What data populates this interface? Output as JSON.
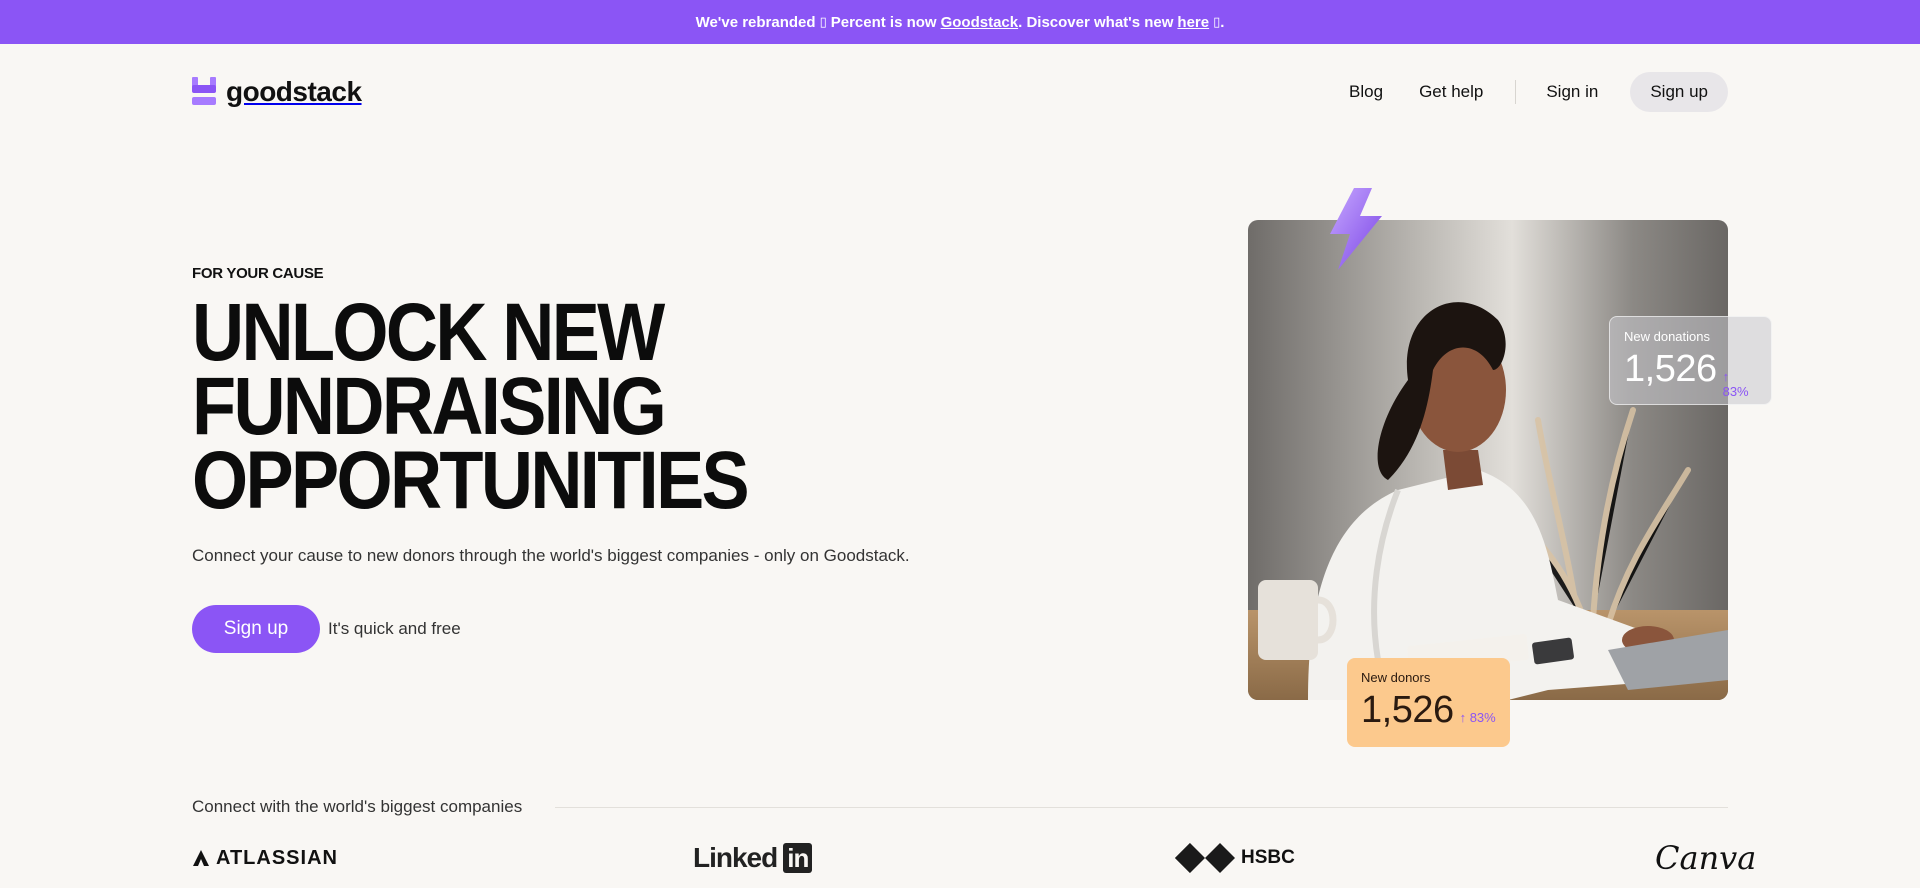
{
  "banner": {
    "prefix": "We've rebranded",
    "glyph_1": "▯",
    "middle": "Percent is now",
    "brand_link": "Goodstack",
    "after_brand": ". Discover what's new",
    "here_link": "here",
    "glyph_2": "▯",
    "end": "."
  },
  "nav": {
    "logo_text": "goodstack",
    "links": [
      "Blog",
      "Get help"
    ],
    "signin": "Sign in",
    "signup": "Sign up"
  },
  "hero": {
    "eyebrow": "FOR YOUR CAUSE",
    "headline": [
      "UNLOCK NEW",
      "FUNDRAISING",
      "OPPORTUNITIES"
    ],
    "subtext": "Connect your cause to new donors through the world's biggest companies - only on Goodstack.",
    "cta": "Sign up",
    "cta_note": "It's quick and free"
  },
  "stats": {
    "donations": {
      "label": "New donations",
      "value": "1,526",
      "delta": "↑ 83%"
    },
    "donors": {
      "label": "New donors",
      "value": "1,526",
      "delta": "↑ 83%"
    }
  },
  "partners": {
    "label": "Connect with the world's biggest companies",
    "logos": {
      "atlassian": "ATLASSIAN",
      "linkedin": "Linked",
      "linkedin_in": "in",
      "hsbc": "HSBC",
      "canva": "Canva"
    }
  },
  "colors": {
    "brand": "#8b55f5",
    "background": "#f9f7f4",
    "donor_card": "#fcc98d"
  }
}
